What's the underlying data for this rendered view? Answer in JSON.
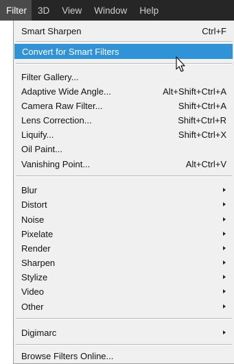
{
  "menubar": {
    "items": [
      {
        "label": "Filter",
        "active": true
      },
      {
        "label": "3D"
      },
      {
        "label": "View"
      },
      {
        "label": "Window"
      },
      {
        "label": "Help"
      }
    ]
  },
  "menu": {
    "items": [
      {
        "label": "Smart Sharpen",
        "shortcut": "Ctrl+F"
      },
      {
        "label": "Convert for Smart Filters",
        "highlighted": true
      },
      {
        "label": "Filter Gallery..."
      },
      {
        "label": "Adaptive Wide Angle...",
        "shortcut": "Alt+Shift+Ctrl+A"
      },
      {
        "label": "Camera Raw Filter...",
        "shortcut": "Shift+Ctrl+A"
      },
      {
        "label": "Lens Correction...",
        "shortcut": "Shift+Ctrl+R"
      },
      {
        "label": "Liquify...",
        "shortcut": "Shift+Ctrl+X"
      },
      {
        "label": "Oil Paint..."
      },
      {
        "label": "Vanishing Point...",
        "shortcut": "Alt+Ctrl+V"
      },
      {
        "label": "Blur",
        "submenu": true
      },
      {
        "label": "Distort",
        "submenu": true
      },
      {
        "label": "Noise",
        "submenu": true
      },
      {
        "label": "Pixelate",
        "submenu": true
      },
      {
        "label": "Render",
        "submenu": true
      },
      {
        "label": "Sharpen",
        "submenu": true
      },
      {
        "label": "Stylize",
        "submenu": true
      },
      {
        "label": "Video",
        "submenu": true
      },
      {
        "label": "Other",
        "submenu": true
      },
      {
        "label": "Digimarc",
        "submenu": true
      },
      {
        "label": "Browse Filters Online..."
      }
    ]
  },
  "colors": {
    "highlight": "#3193d7",
    "menubar": "#262626",
    "menu_bg": "#f0f0f0"
  },
  "icons": {
    "cursor": "arrow-pointer-icon",
    "submenu": "submenu-arrow-icon"
  }
}
